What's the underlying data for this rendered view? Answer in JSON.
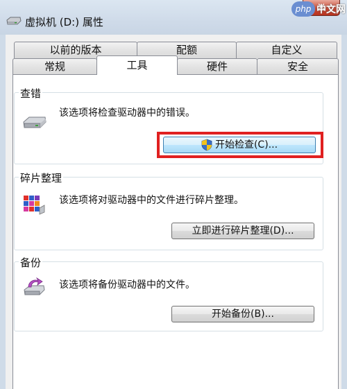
{
  "window": {
    "title": "虚拟机 (D:) 属性",
    "close_label": "✕"
  },
  "watermark": {
    "logo": "php",
    "text": "中文网"
  },
  "tabs": {
    "row_back": [
      {
        "label": "以前的版本"
      },
      {
        "label": "配额"
      },
      {
        "label": "自定义"
      }
    ],
    "row_front": [
      {
        "label": "常规"
      },
      {
        "label": "工具",
        "active": true
      },
      {
        "label": "硬件"
      },
      {
        "label": "安全"
      }
    ]
  },
  "error_checking": {
    "title": "查错",
    "description": "该选项将检查驱动器中的错误。",
    "button_label": "开始检查(C)...",
    "icon": "drive-icon"
  },
  "defrag": {
    "title": "碎片整理",
    "description": "该选项将对驱动器中的文件进行碎片整理。",
    "button_label": "立即进行碎片整理(D)...",
    "icon": "defrag-icon"
  },
  "backup": {
    "title": "备份",
    "description": "该选项将备份驱动器中的文件。",
    "button_label": "开始备份(B)...",
    "icon": "backup-icon"
  },
  "colors": {
    "highlight": "#e02020",
    "close": "#c74a36"
  }
}
